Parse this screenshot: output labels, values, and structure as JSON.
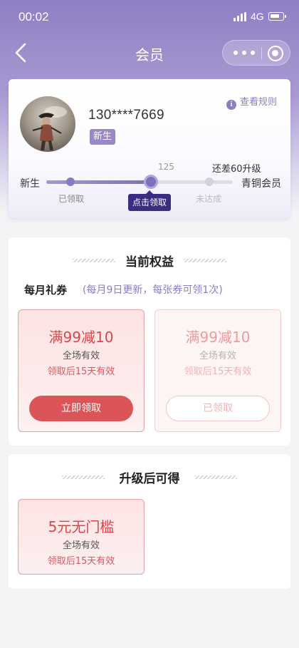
{
  "status_bar": {
    "time": "00:02",
    "network": "4G"
  },
  "nav": {
    "title": "会员"
  },
  "member": {
    "phone": "130****7669",
    "level": "新生",
    "rules_label": "查看规则",
    "progress_value": "125",
    "progress_fraction": 0.56,
    "remaining_label": "还差60升级",
    "current_level": "新生",
    "next_level": "青铜会员",
    "stages": [
      {
        "label": "已领取",
        "status": "claimed"
      },
      {
        "label": "点击领取",
        "status": "claimable"
      },
      {
        "label": "未达成",
        "status": "locked"
      }
    ]
  },
  "current_benefits": {
    "title": "当前权益",
    "monthly_label": "每月礼券",
    "monthly_note": "(每月9日更新，每张券可领1次)",
    "coupons": [
      {
        "amount": "满99减10",
        "scope": "全场有效",
        "validity": "领取后15天有效",
        "button": "立即领取",
        "state": "available"
      },
      {
        "amount": "满99减10",
        "scope": "全场有效",
        "validity": "领取后15天有效",
        "button": "已领取",
        "state": "claimed"
      }
    ]
  },
  "upgrade_benefits": {
    "title": "升级后可得",
    "coupons": [
      {
        "amount": "5元无门槛",
        "scope": "全场有效",
        "validity": "领取后15天有效"
      }
    ]
  },
  "colors": {
    "accent": "#8a7bc3",
    "coupon_red": "#d9464b",
    "tooltip": "#3c2c83"
  },
  "icons": [
    "back-icon",
    "more-icon",
    "target-icon",
    "info-icon",
    "signal-icon",
    "battery-icon"
  ]
}
